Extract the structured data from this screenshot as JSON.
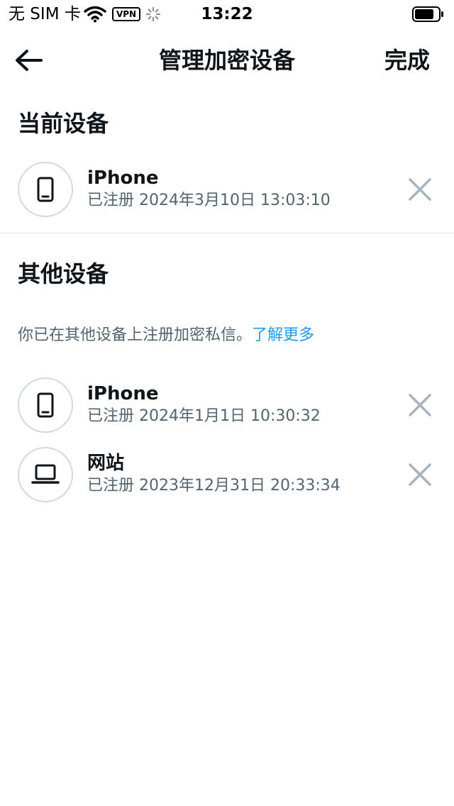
{
  "status_bar": {
    "carrier": "无 SIM 卡",
    "vpn_label": "VPN",
    "time": "13:22"
  },
  "nav": {
    "title": "管理加密设备",
    "done_label": "完成"
  },
  "current_section": {
    "title": "当前设备",
    "devices": [
      {
        "name": "iPhone",
        "registered": "已注册 2024年3月10日 13:03:10",
        "icon": "phone-icon"
      }
    ]
  },
  "other_section": {
    "title": "其他设备",
    "info_text": "你已在其他设备上注册加密私信。",
    "learn_more": "了解更多",
    "devices": [
      {
        "name": "iPhone",
        "registered": "已注册 2024年1月1日 10:30:32",
        "icon": "phone-icon"
      },
      {
        "name": "网站",
        "registered": "已注册 2023年12月31日 20:33:34",
        "icon": "laptop-icon"
      }
    ]
  },
  "colors": {
    "text_primary": "#0f1419",
    "text_secondary": "#536471",
    "link": "#1d9bf0",
    "icon_border": "#cfd9de",
    "close_icon": "#a7b4bd"
  }
}
